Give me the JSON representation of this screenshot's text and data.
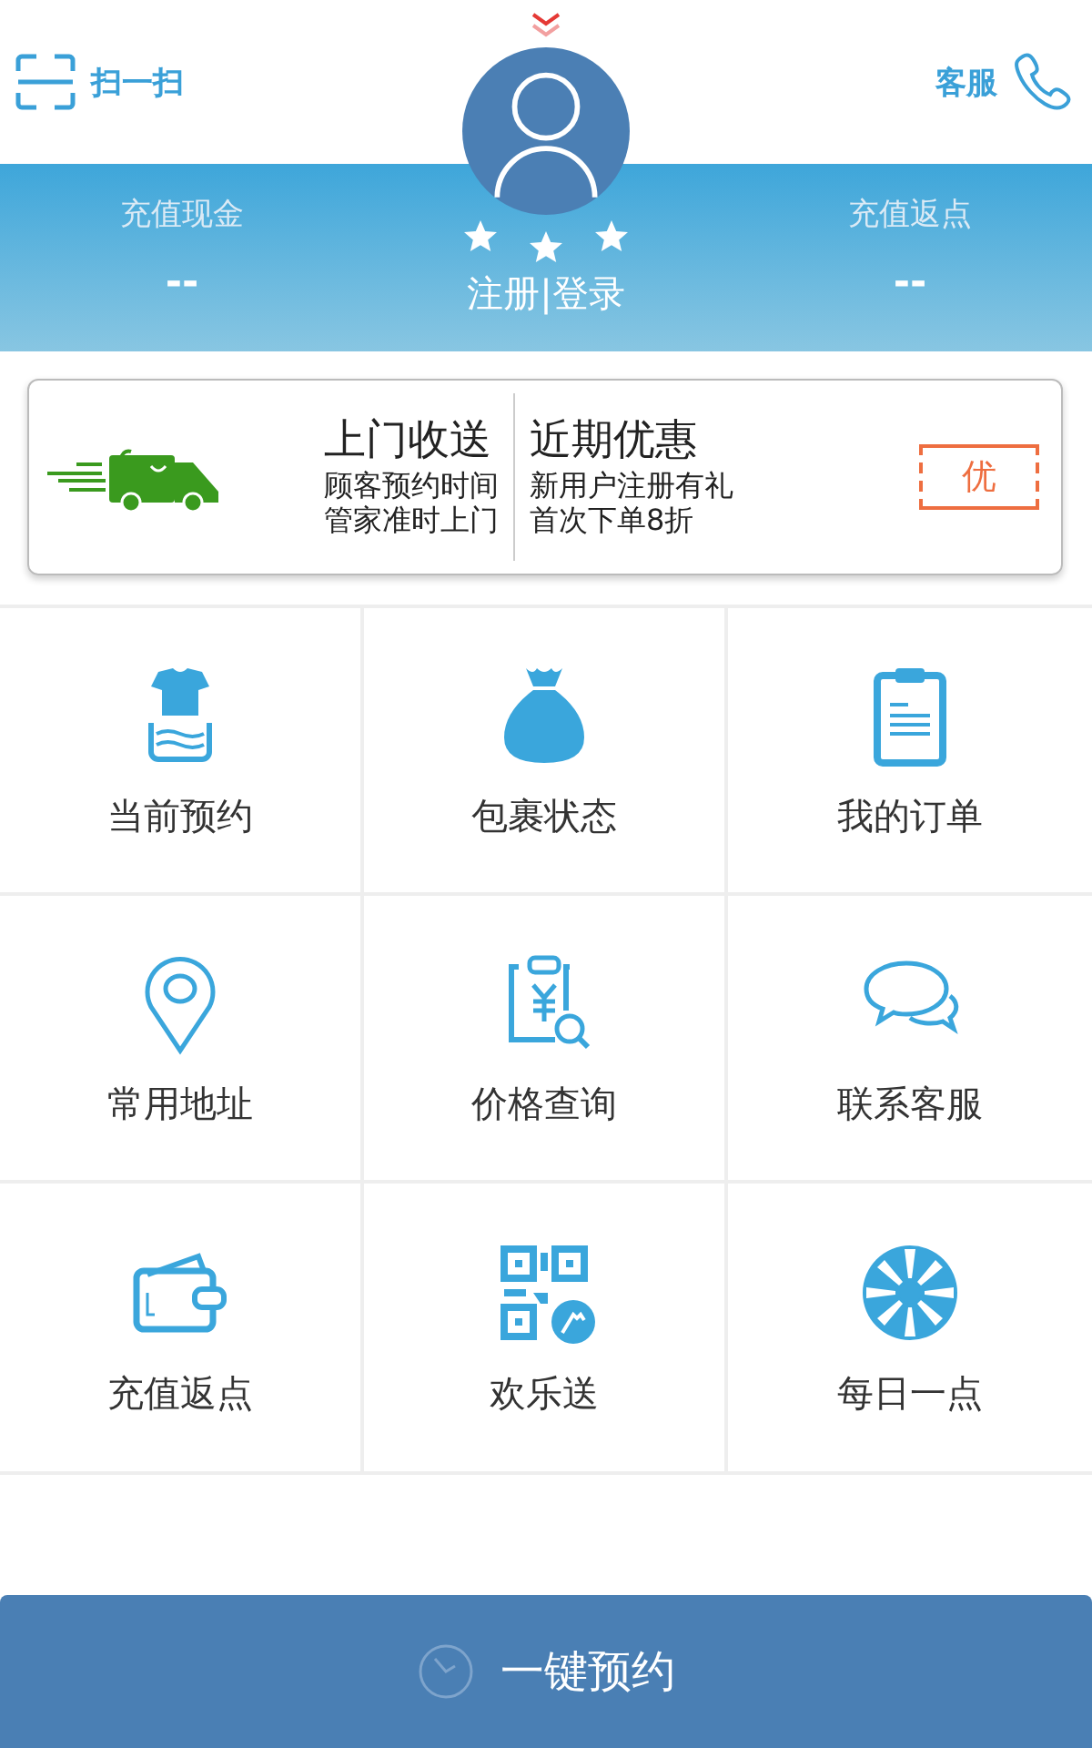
{
  "header": {
    "scan_label": "扫一扫",
    "service_label": "客服"
  },
  "account": {
    "left_label": "充值现金",
    "left_value": "--",
    "right_label": "充值返点",
    "right_value": "--",
    "stars": 3,
    "login": "注册|登录"
  },
  "promo": {
    "left_title": "上门收送",
    "left_lines": [
      "顾客预约时间",
      "管家准时上门"
    ],
    "right_title": "近期优惠",
    "right_lines": [
      "新用户注册有礼",
      "首次下单8折"
    ],
    "badge": "优"
  },
  "menu": [
    {
      "kind": "laundry",
      "label": "当前预约"
    },
    {
      "kind": "bag",
      "label": "包裹状态"
    },
    {
      "kind": "clipboard",
      "label": "我的订单"
    },
    {
      "kind": "pin",
      "label": "常用地址"
    },
    {
      "kind": "price",
      "label": "价格查询"
    },
    {
      "kind": "chat",
      "label": "联系客服"
    },
    {
      "kind": "wallet",
      "label": "充值返点"
    },
    {
      "kind": "qr",
      "label": "欢乐送"
    },
    {
      "kind": "wheel",
      "label": "每日一点"
    }
  ],
  "book_button": "一键预约"
}
